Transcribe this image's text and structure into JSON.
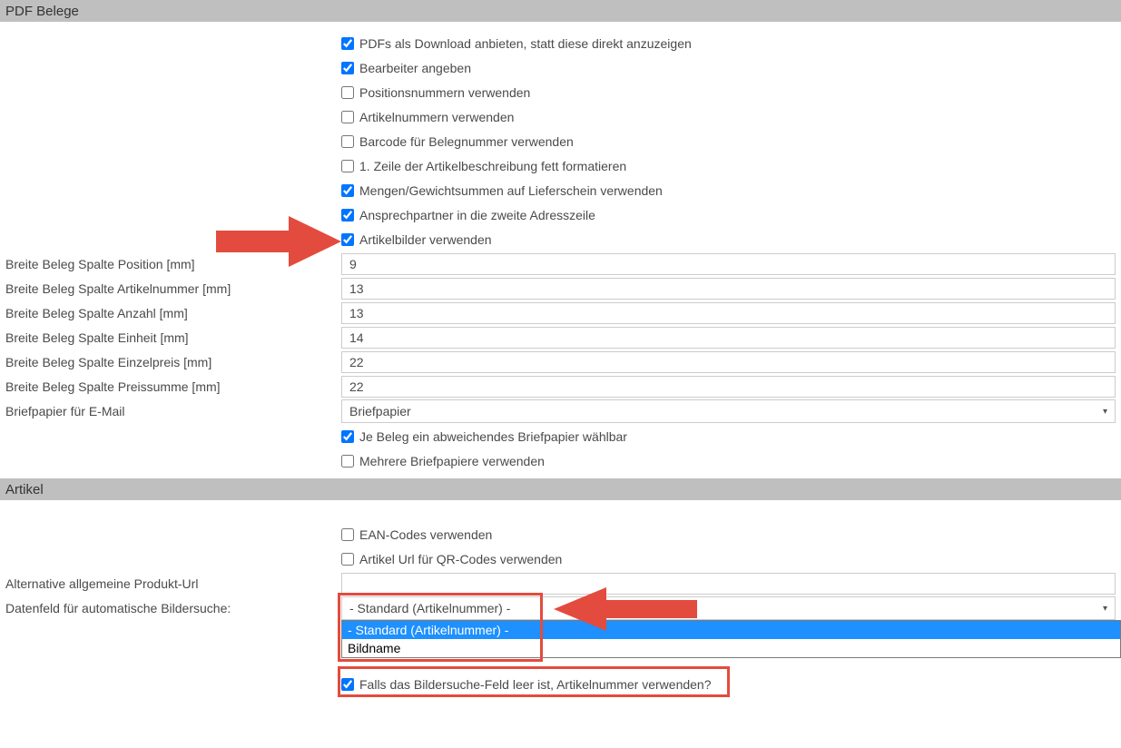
{
  "sections": {
    "pdf": {
      "title": "PDF Belege",
      "checkboxes": [
        {
          "label": "PDFs als Download anbieten, statt diese direkt anzuzeigen",
          "checked": true
        },
        {
          "label": "Bearbeiter angeben",
          "checked": true
        },
        {
          "label": "Positionsnummern verwenden",
          "checked": false
        },
        {
          "label": "Artikelnummern verwenden",
          "checked": false
        },
        {
          "label": "Barcode für Belegnummer verwenden",
          "checked": false
        },
        {
          "label": "1. Zeile der Artikelbeschreibung fett formatieren",
          "checked": false
        },
        {
          "label": "Mengen/Gewichtsummen auf Lieferschein verwenden",
          "checked": true
        },
        {
          "label": "Ansprechpartner in die zweite Adresszeile",
          "checked": true
        },
        {
          "label": "Artikelbilder verwenden",
          "checked": true
        }
      ],
      "fields": [
        {
          "label": "Breite Beleg Spalte Position [mm]",
          "value": "9"
        },
        {
          "label": "Breite Beleg Spalte Artikelnummer [mm]",
          "value": "13"
        },
        {
          "label": "Breite Beleg Spalte Anzahl [mm]",
          "value": "13"
        },
        {
          "label": "Breite Beleg Spalte Einheit [mm]",
          "value": "14"
        },
        {
          "label": "Breite Beleg Spalte Einzelpreis [mm]",
          "value": "22"
        },
        {
          "label": "Breite Beleg Spalte Preissumme [mm]",
          "value": "22"
        }
      ],
      "briefpapier": {
        "label": "Briefpapier für E-Mail",
        "selected": "Briefpapier"
      },
      "checkboxes2": [
        {
          "label": "Je Beleg ein abweichendes Briefpapier wählbar",
          "checked": true
        },
        {
          "label": "Mehrere Briefpapiere verwenden",
          "checked": false
        }
      ]
    },
    "artikel": {
      "title": "Artikel",
      "checkboxes": [
        {
          "label": "EAN-Codes verwenden",
          "checked": false
        },
        {
          "label": "Artikel Url für QR-Codes verwenden",
          "checked": false
        }
      ],
      "altUrl": {
        "label": "Alternative allgemeine Produkt-Url",
        "value": ""
      },
      "datenfeld": {
        "label": "Datenfeld für automatische Bildersuche:",
        "selected": "- Standard (Artikelnummer) -",
        "options": [
          "- Standard (Artikelnummer) -",
          "Bildname"
        ]
      },
      "fallback": {
        "label": "Falls das Bildersuche-Feld leer ist, Artikelnummer verwenden?",
        "checked": true
      }
    }
  },
  "caret": "▾"
}
